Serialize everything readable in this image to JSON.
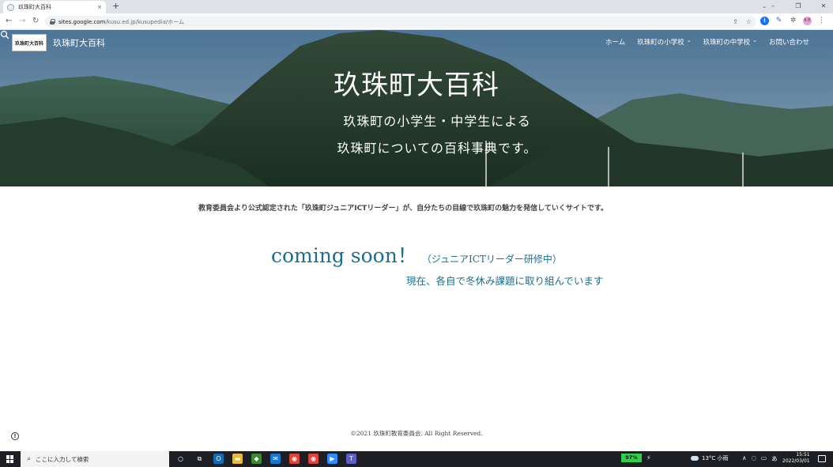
{
  "browser": {
    "tab_title": "玖珠町大百科",
    "tab_close": "×",
    "new_tab": "+",
    "tabstrip_chevron": "⌄",
    "window_controls": [
      "–",
      "❐",
      "✕"
    ],
    "nav": {
      "back": "←",
      "forward": "→",
      "reload": "↻"
    },
    "url_host": "sites.google.com",
    "url_path": "/kusu.ed.jp/kusupedia/ホーム",
    "omnibox_icons": [
      "⇪",
      "☆"
    ],
    "extensions": {
      "info": "i",
      "pen": "✎",
      "puzzle": "✲",
      "avatar": "K·E",
      "more": "⋮"
    }
  },
  "site": {
    "logo_text": "玖珠町大百科",
    "name": "玖珠町大百科",
    "nav": [
      {
        "label": "ホーム",
        "chevron": ""
      },
      {
        "label": "玖珠町の小学校",
        "chevron": "⌄"
      },
      {
        "label": "玖珠町の中学校",
        "chevron": "⌄"
      },
      {
        "label": "お問い合わせ",
        "chevron": ""
      }
    ],
    "hero_title": "玖珠町大百科",
    "hero_subtitle_1": "玖珠町の小学生・中学生による",
    "hero_subtitle_2": "玖珠町についての百科事典です。"
  },
  "content": {
    "intro": "教育委員会より公式認定された「玖珠町ジュニアICTリーダー」が、自分たちの目線で玖珠町の魅力を発信していくサイトです。",
    "coming_soon": "coming soon！",
    "coming_note": "（ジュニアICTリーダー研修中）",
    "status": "現在、各自で冬休み課題に取り組んでいます",
    "footer": "©2021 玖珠町教育委員会. All Right Reserved.",
    "report_icon": "!"
  },
  "taskbar": {
    "search_placeholder": "ここに入力して検索",
    "search_icon": "⌕",
    "apps": [
      {
        "name": "cortana-icon",
        "glyph": "○",
        "color": "transparent"
      },
      {
        "name": "task-view-icon",
        "glyph": "⧉",
        "color": "transparent"
      },
      {
        "name": "outlook-icon",
        "glyph": "O",
        "color": "#0f6cbd"
      },
      {
        "name": "file-explorer-icon",
        "glyph": "▬",
        "color": "#e8b93a"
      },
      {
        "name": "shield-app-icon",
        "glyph": "◆",
        "color": "#3b8a2f"
      },
      {
        "name": "mail-icon",
        "glyph": "✉",
        "color": "#1478d4"
      },
      {
        "name": "chrome-icon",
        "glyph": "◉",
        "color": "#db4437"
      },
      {
        "name": "chrome-profile-icon",
        "glyph": "◉",
        "color": "#db4437"
      },
      {
        "name": "zoom-icon",
        "glyph": "▶",
        "color": "#2d8cff"
      },
      {
        "name": "teams-icon",
        "glyph": "T",
        "color": "#5b5fc7"
      }
    ],
    "battery": "97%",
    "plug": "⚡",
    "weather": "13°C 小雨",
    "tray_icons": [
      "∧",
      "◌",
      "▭",
      "あ"
    ],
    "time": "15:51",
    "date": "2022/03/01"
  }
}
